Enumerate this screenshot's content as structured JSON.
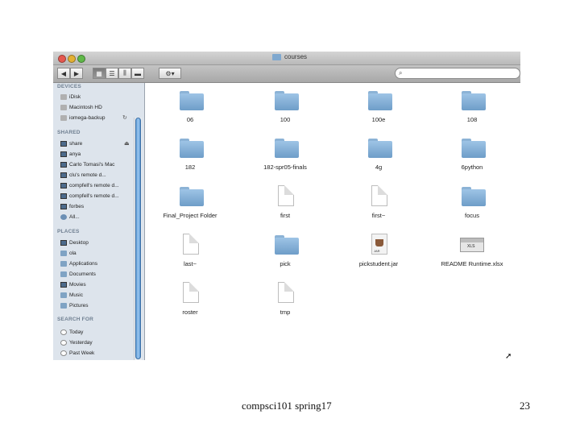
{
  "window": {
    "title": "courses"
  },
  "search": {
    "placeholder": ""
  },
  "sidebar": {
    "devices": {
      "header": "DEVICES",
      "items": [
        {
          "label": "iDisk",
          "icon": "idisk-icon"
        },
        {
          "label": "Macintosh HD",
          "icon": "hard-drive-icon"
        },
        {
          "label": "iomega-backup",
          "icon": "external-drive-icon"
        }
      ]
    },
    "shared": {
      "header": "SHARED",
      "items": [
        {
          "label": "share",
          "icon": "network-screen-icon"
        },
        {
          "label": "anya",
          "icon": "network-screen-icon"
        },
        {
          "label": "Carlo Tomasi's Mac",
          "icon": "network-screen-icon"
        },
        {
          "label": "clu's remote d...",
          "icon": "network-screen-icon"
        },
        {
          "label": "compfell's remote d...",
          "icon": "network-screen-icon"
        },
        {
          "label": "compfell's remote d...",
          "icon": "network-screen-icon"
        },
        {
          "label": "forbes",
          "icon": "network-screen-icon"
        },
        {
          "label": "All...",
          "icon": "network-globe-icon"
        }
      ]
    },
    "places": {
      "header": "PLACES",
      "items": [
        {
          "label": "Desktop",
          "icon": "desktop-icon"
        },
        {
          "label": "ola",
          "icon": "home-icon"
        },
        {
          "label": "Applications",
          "icon": "applications-icon"
        },
        {
          "label": "Documents",
          "icon": "documents-icon"
        },
        {
          "label": "Movies",
          "icon": "movies-icon"
        },
        {
          "label": "Music",
          "icon": "music-icon"
        },
        {
          "label": "Pictures",
          "icon": "pictures-icon"
        }
      ]
    },
    "search_for": {
      "header": "SEARCH FOR",
      "items": [
        {
          "label": "Today",
          "icon": "clock-icon"
        },
        {
          "label": "Yesterday",
          "icon": "clock-icon"
        },
        {
          "label": "Past Week",
          "icon": "clock-icon"
        }
      ]
    }
  },
  "files": [
    {
      "name": "06",
      "kind": "folder"
    },
    {
      "name": "100",
      "kind": "folder"
    },
    {
      "name": "100e",
      "kind": "folder"
    },
    {
      "name": "108",
      "kind": "folder"
    },
    {
      "name": "182",
      "kind": "folder"
    },
    {
      "name": "182-spr05-finals",
      "kind": "folder"
    },
    {
      "name": "4g",
      "kind": "folder"
    },
    {
      "name": "6python",
      "kind": "folder"
    },
    {
      "name": "Final_Project Folder",
      "kind": "folder"
    },
    {
      "name": "first",
      "kind": "document"
    },
    {
      "name": "first~",
      "kind": "document"
    },
    {
      "name": "focus",
      "kind": "folder"
    },
    {
      "name": "last~",
      "kind": "document"
    },
    {
      "name": "pick",
      "kind": "folder"
    },
    {
      "name": "pickstudent.jar",
      "kind": "jar"
    },
    {
      "name": "README Runtime.xlsx",
      "kind": "spreadsheet"
    },
    {
      "name": "roster",
      "kind": "document"
    },
    {
      "name": "tmp",
      "kind": "document"
    }
  ],
  "slide": {
    "footer": "compsci101 spring17",
    "page": "23"
  }
}
